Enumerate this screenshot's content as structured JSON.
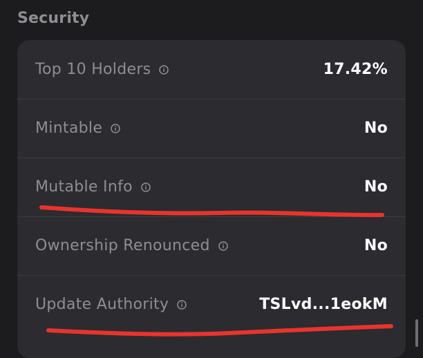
{
  "section": {
    "title": "Security"
  },
  "rows": [
    {
      "label": "Top 10 Holders",
      "value": "17.42%",
      "icon": "info-icon"
    },
    {
      "label": "Mintable",
      "value": "No",
      "icon": "info-icon"
    },
    {
      "label": "Mutable Info",
      "value": "No",
      "icon": "info-icon"
    },
    {
      "label": "Ownership Renounced",
      "value": "No",
      "icon": "info-icon"
    },
    {
      "label": "Update Authority",
      "value": "TSLvd...1eokM",
      "icon": "info-icon"
    }
  ],
  "colors": {
    "background": "#1c1c1e",
    "card": "#2b2b30",
    "label": "#8e8e93",
    "value": "#ffffff",
    "annotation": "#e8342d"
  }
}
